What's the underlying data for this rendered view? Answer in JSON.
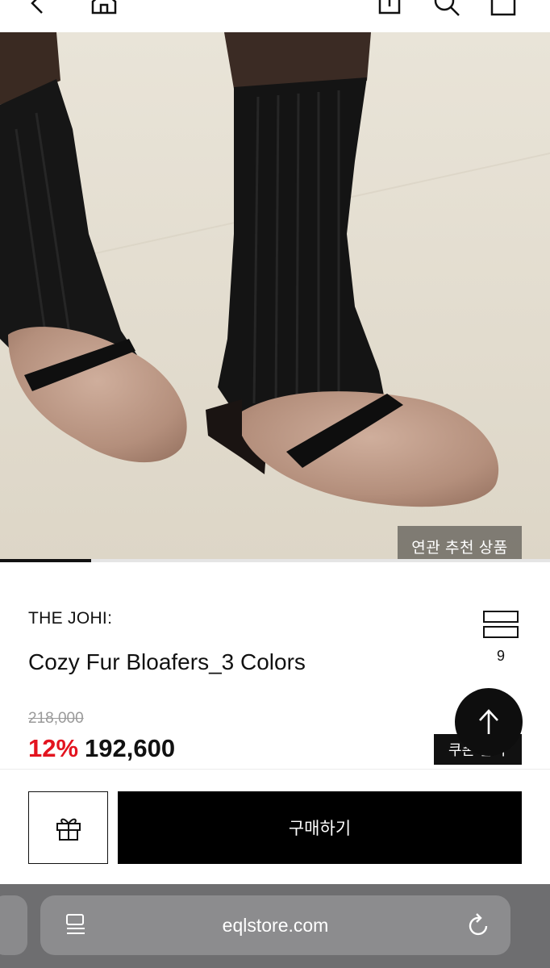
{
  "top_bar": {
    "icons": [
      "back-arrow-icon",
      "home-icon",
      "share-icon",
      "search-icon",
      "cart-icon"
    ]
  },
  "hero": {
    "related_button": "연관 추천 상품",
    "image_progress": 0.166
  },
  "product": {
    "brand": "THE JOHI:",
    "name": "Cozy Fur Bloafers_3 Colors",
    "compare_count": "9",
    "original_price": "218,000",
    "discount": "12%",
    "price": "192,600"
  },
  "floating": {
    "coupon_label": "쿠폰 받기",
    "scroll_top_icon": "arrow-up-icon"
  },
  "actions": {
    "gift_icon": "gift-icon",
    "buy_label": "구매하기"
  },
  "browser": {
    "url": "eqlstore.com",
    "left_icon": "reader-icon",
    "right_icon": "reload-icon"
  },
  "colors": {
    "accent_red": "#e3141f",
    "primary_black": "#000000",
    "browser_gray": "#6e6e70"
  }
}
